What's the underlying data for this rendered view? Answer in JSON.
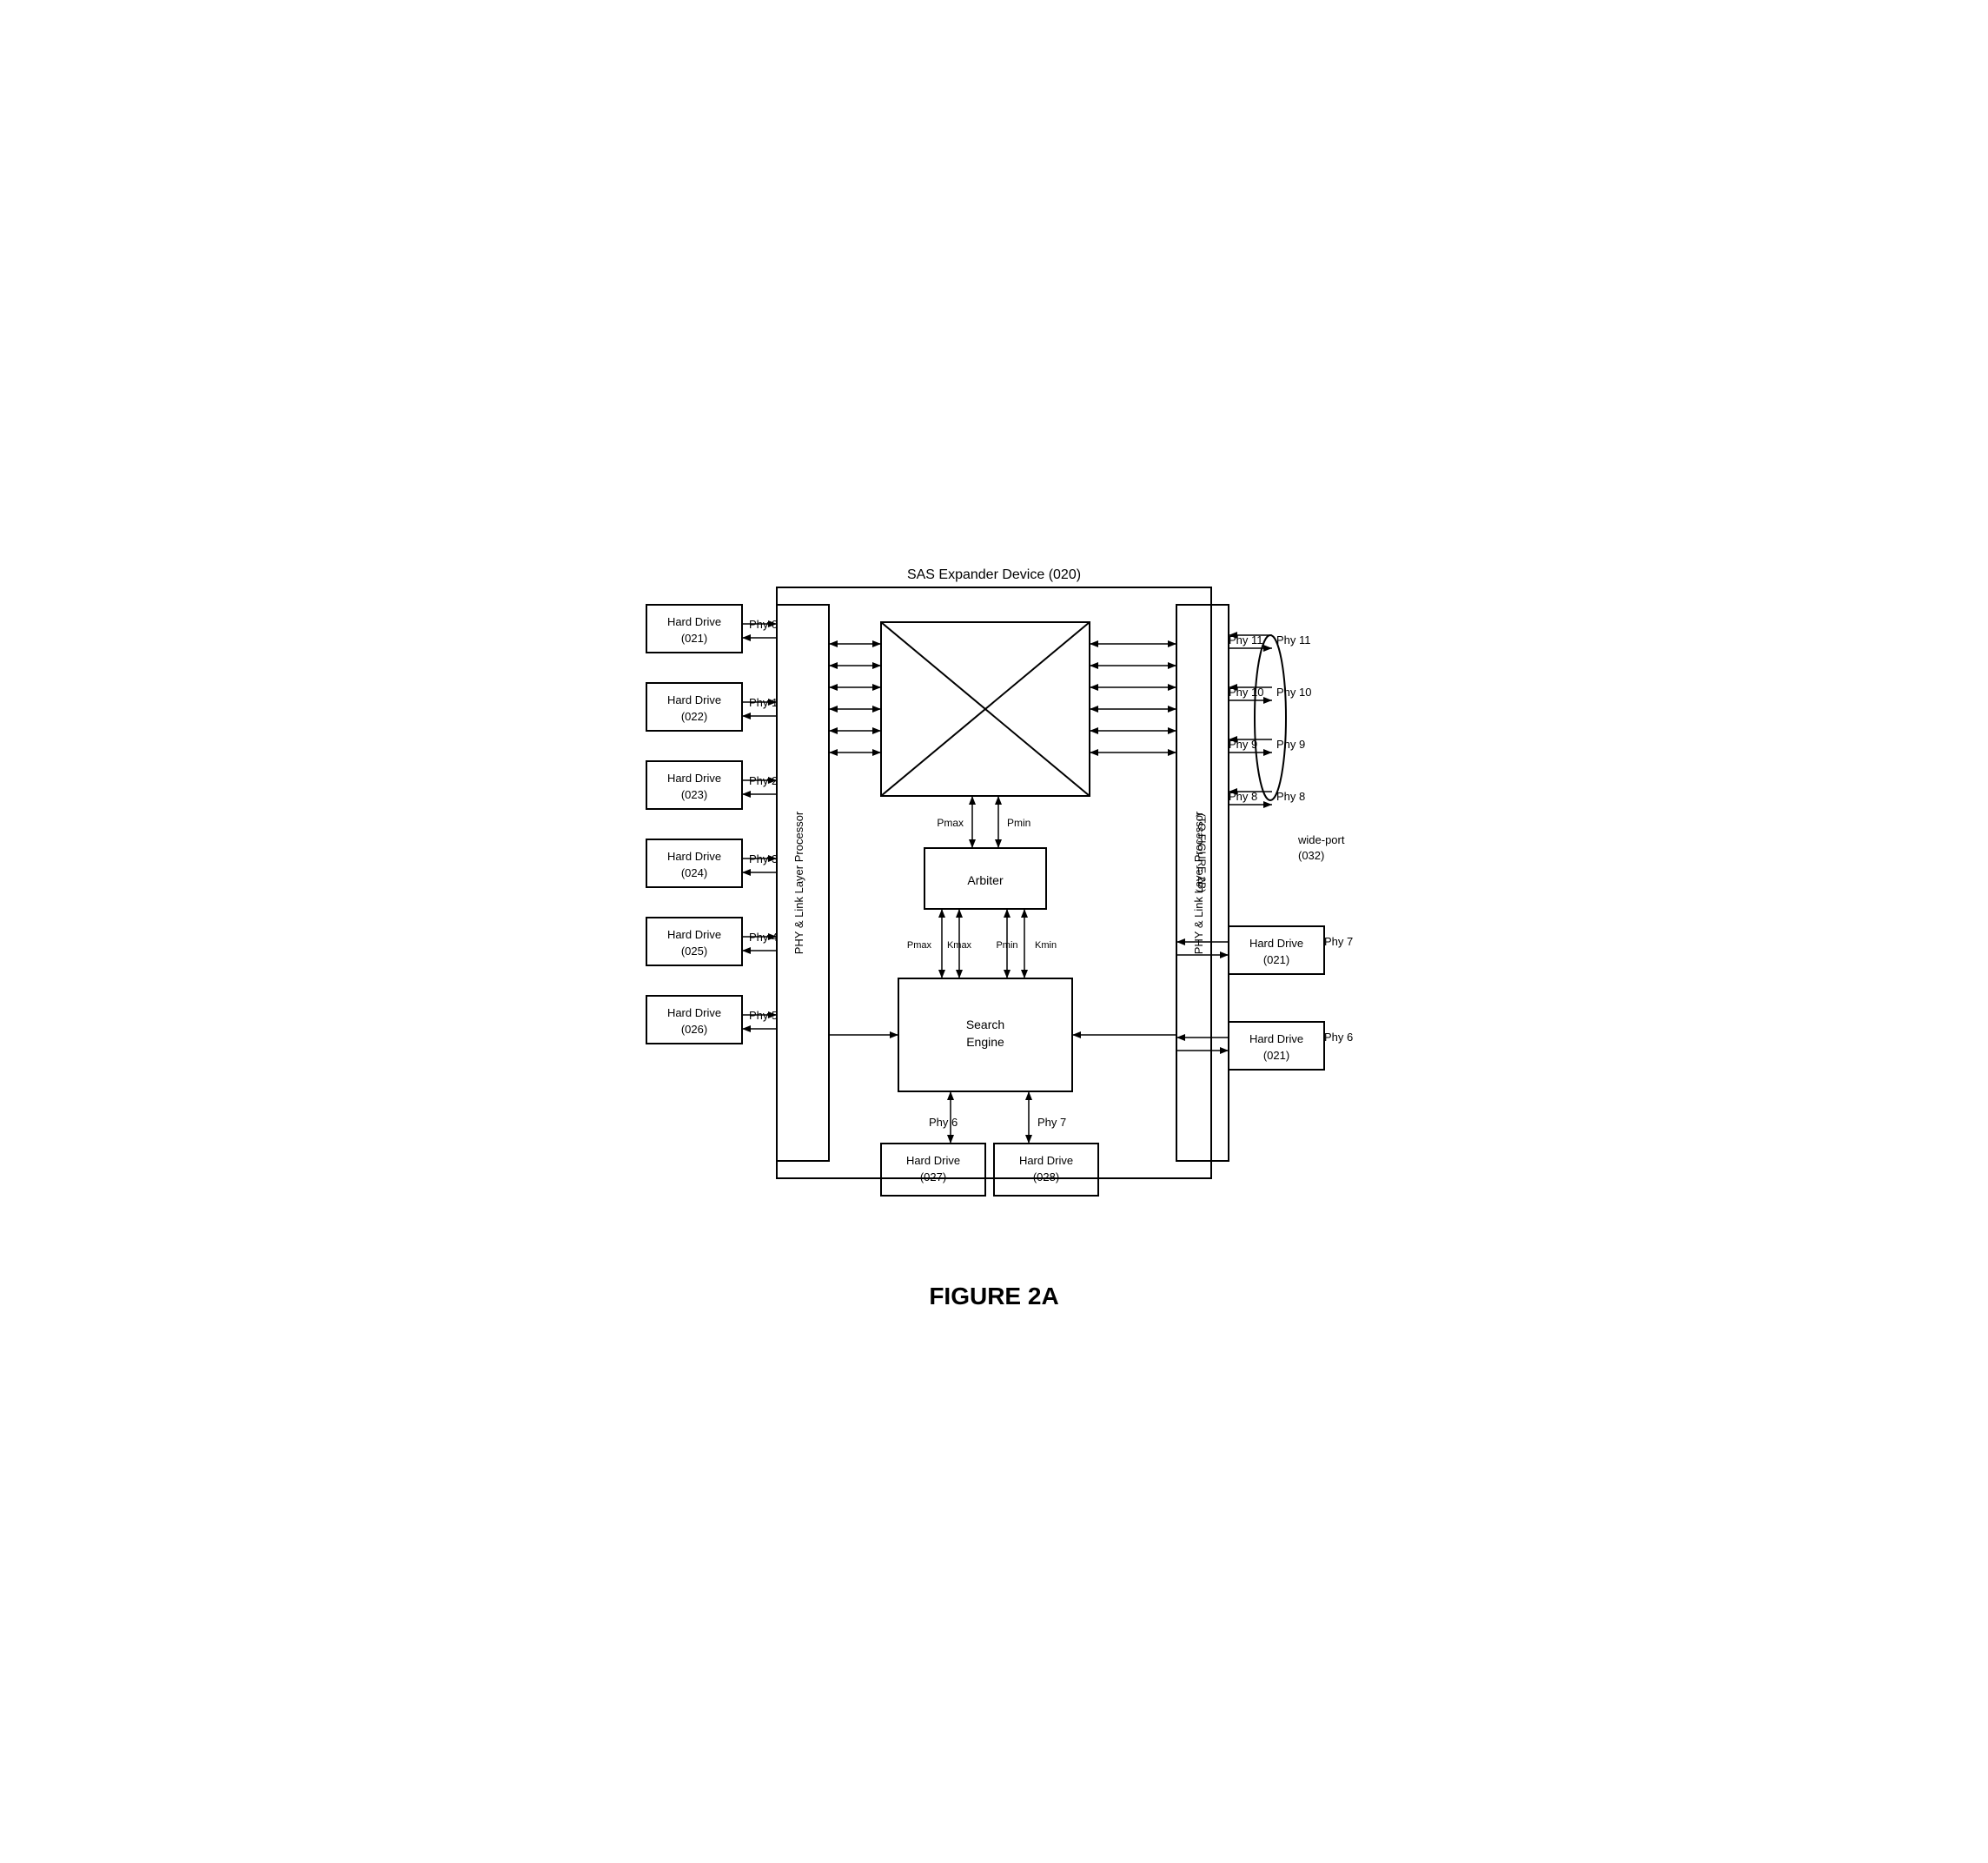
{
  "title": "FIGURE 2A",
  "diagram": {
    "sas_expander_label": "SAS Expander Device (020)",
    "crossbar_label": "",
    "arbiter_label": "Arbiter",
    "search_engine_label": "Search\nEngine",
    "phy_link_left_label": "PHY & Link Layer Processor",
    "phy_link_right_label": "PHY & Link Layer Processor",
    "wide_port_label": "wide-port\n(032)",
    "to_figure_label": "(TO FIGURE 2B)",
    "left_drives": [
      {
        "label": "Hard Drive\n(021)",
        "phy": "Phy 0"
      },
      {
        "label": "Hard Drive\n(022)",
        "phy": "Phy 1"
      },
      {
        "label": "Hard Drive\n(023)",
        "phy": "Phy 2"
      },
      {
        "label": "Hard Drive\n(024)",
        "phy": "Phy 3"
      },
      {
        "label": "Hard Drive\n(025)",
        "phy": "Phy 4"
      },
      {
        "label": "Hard Drive\n(026)",
        "phy": "Phy 5"
      }
    ],
    "bottom_drives": [
      {
        "label": "Hard Drive\n(027)",
        "phy": "Phy 6"
      },
      {
        "label": "Hard Drive\n(028)",
        "phy": "Phy 7"
      }
    ],
    "right_drives": [
      {
        "label": "Hard Drive\n(021)",
        "phy": "Phy 7"
      },
      {
        "label": "Hard Drive\n(021)",
        "phy": "Phy 6"
      }
    ],
    "right_phys": [
      {
        "label": "Phy 11",
        "pair": "Phy 11"
      },
      {
        "label": "Phy 10",
        "pair": "Phy 10"
      },
      {
        "label": "Phy 9",
        "pair": "Phy 9"
      },
      {
        "label": "Phy 8",
        "pair": "Phy 8"
      }
    ],
    "signal_labels": {
      "pmax_top": "Pmax",
      "pmin_top": "Pmin",
      "pmax_bottom": "Pmax",
      "kmax": "Kmax",
      "pmin_bottom": "Pmin",
      "kmin": "Kmin"
    }
  }
}
